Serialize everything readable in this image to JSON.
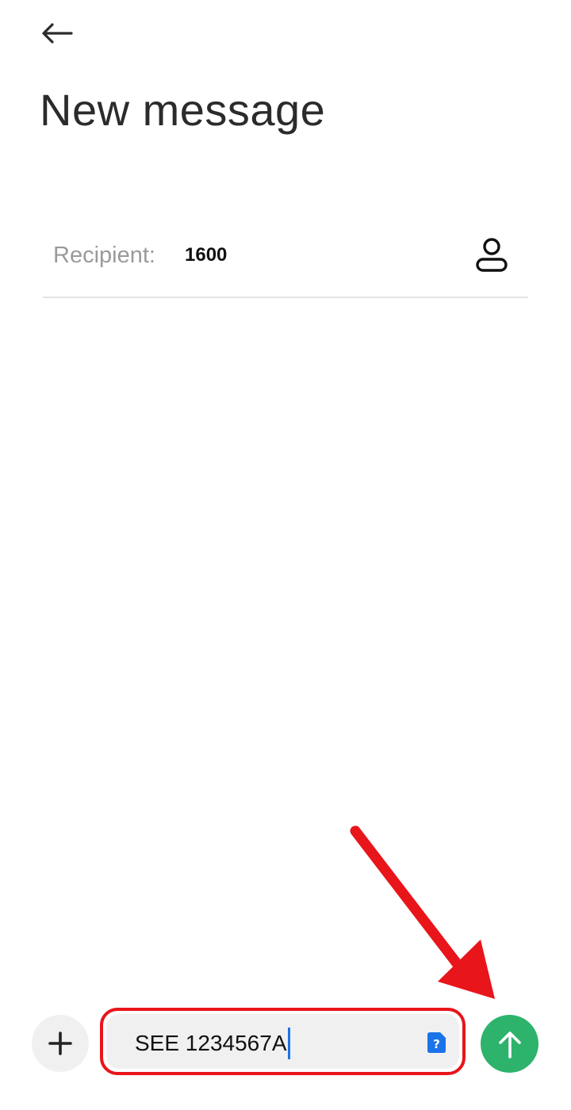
{
  "header": {
    "back_icon": "arrow-left-icon",
    "title": "New message"
  },
  "recipient": {
    "label": "Recipient:",
    "value": "1600",
    "contact_icon": "person-icon"
  },
  "composer": {
    "add_icon": "plus-icon",
    "message_text": "SEE 1234567A",
    "sim_icon": "sim-card-icon",
    "sim_badge": "?",
    "send_icon": "arrow-up-icon"
  },
  "colors": {
    "send_button": "#2db36b",
    "annotation": "#e8151b",
    "caret": "#1a73e8",
    "sim_badge": "#1a73e8"
  }
}
